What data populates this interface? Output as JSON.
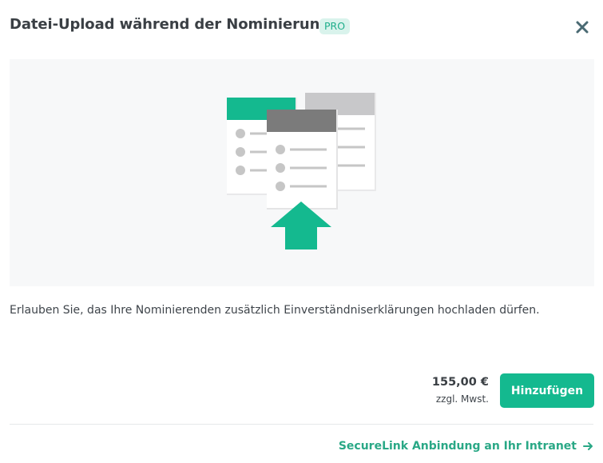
{
  "header": {
    "title": "Datei-Upload während der Nominierung",
    "badge": "PRO",
    "close_icon": "close-icon"
  },
  "hero": {
    "illustration_icon": "document-upload-illustration",
    "colors": {
      "accent": "#14b98f",
      "gray_header": "#7b7b7b",
      "light_gray_header": "#c8c8ca",
      "bullet": "#c6c6c6",
      "background": "#f7f8f9"
    }
  },
  "description": "Erlauben Sie, das Ihre Nominierenden zusätzlich Einverständniserklärungen hochladen dürfen.",
  "pricing": {
    "amount": "155,00 €",
    "tax_note": "zzgl. Mwst."
  },
  "actions": {
    "add_label": "Hinzufügen"
  },
  "footer": {
    "link_label": "SecureLink Anbindung an Ihr Intranet",
    "arrow_icon": "arrow-right-icon"
  },
  "theme": {
    "accent": "#14b98f",
    "link": "#2aa886",
    "badge_bg": "#d9f3ec"
  }
}
